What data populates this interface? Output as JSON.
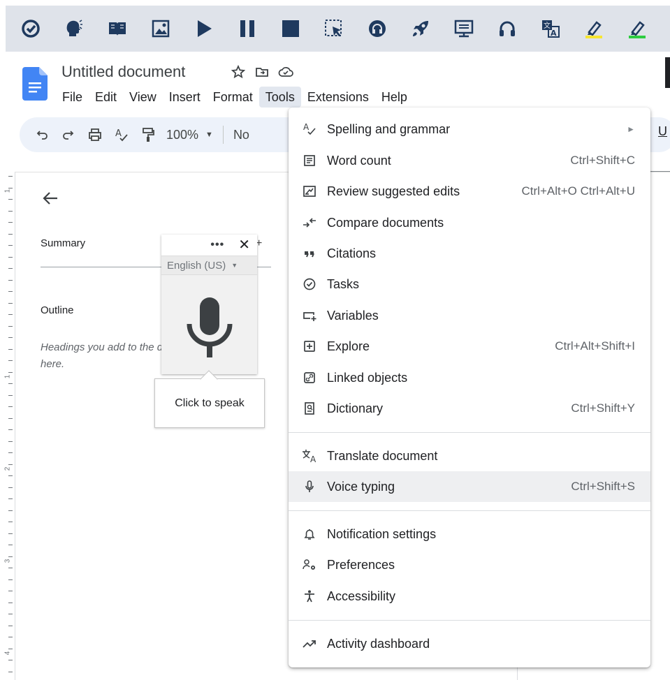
{
  "extension_toolbar": {
    "icons": [
      "check-circle-icon",
      "talk-head-icon",
      "book-icon",
      "image-icon",
      "play-icon",
      "pause-icon",
      "stop-icon",
      "screen-select-icon",
      "audio-icon",
      "rocket-icon",
      "monitor-icon",
      "headphones-icon",
      "translate-icon",
      "highlighter-yellow-icon",
      "highlighter-green-icon"
    ]
  },
  "document": {
    "title": "Untitled document",
    "menus": [
      "File",
      "Edit",
      "View",
      "Insert",
      "Format",
      "Tools",
      "Extensions",
      "Help"
    ],
    "active_menu": "Tools"
  },
  "toolbar": {
    "zoom": "100%",
    "style_truncated": "No",
    "right_truncated": "U"
  },
  "outline_panel": {
    "summary_label": "Summary",
    "outline_label": "Outline",
    "outline_hint": "Headings you add to the document will appear here.",
    "plus": "+"
  },
  "voice_widget": {
    "dots": "•••",
    "close": "✕",
    "language": "English (US)",
    "tooltip": "Click to speak"
  },
  "tools_menu": {
    "items": [
      {
        "label": "Spelling and grammar",
        "shortcut": "",
        "icon": "spellcheck-icon",
        "submenu": true
      },
      {
        "label": "Word count",
        "shortcut": "Ctrl+Shift+C",
        "icon": "word-count-icon"
      },
      {
        "label": "Review suggested edits",
        "shortcut": "Ctrl+Alt+O Ctrl+Alt+U",
        "icon": "review-edits-icon"
      },
      {
        "label": "Compare documents",
        "shortcut": "",
        "icon": "compare-icon"
      },
      {
        "label": "Citations",
        "shortcut": "",
        "icon": "quote-icon"
      },
      {
        "label": "Tasks",
        "shortcut": "",
        "icon": "task-icon"
      },
      {
        "label": "Variables",
        "shortcut": "",
        "icon": "variables-icon"
      },
      {
        "label": "Explore",
        "shortcut": "Ctrl+Alt+Shift+I",
        "icon": "explore-icon"
      },
      {
        "label": "Linked objects",
        "shortcut": "",
        "icon": "link-icon"
      },
      {
        "label": "Dictionary",
        "shortcut": "Ctrl+Shift+Y",
        "icon": "dictionary-icon"
      },
      {
        "label": "Translate document",
        "shortcut": "",
        "icon": "translate-icon"
      },
      {
        "label": "Voice typing",
        "shortcut": "Ctrl+Shift+S",
        "icon": "mic-icon",
        "highlighted": true
      },
      {
        "label": "Notification settings",
        "shortcut": "",
        "icon": "bell-icon"
      },
      {
        "label": "Preferences",
        "shortcut": "",
        "icon": "preferences-icon"
      },
      {
        "label": "Accessibility",
        "shortcut": "",
        "icon": "accessibility-icon"
      },
      {
        "label": "Activity dashboard",
        "shortcut": "",
        "icon": "trending-icon"
      }
    ]
  },
  "ruler": {
    "numbers": [
      "1",
      "1",
      "2",
      "3",
      "4"
    ]
  }
}
